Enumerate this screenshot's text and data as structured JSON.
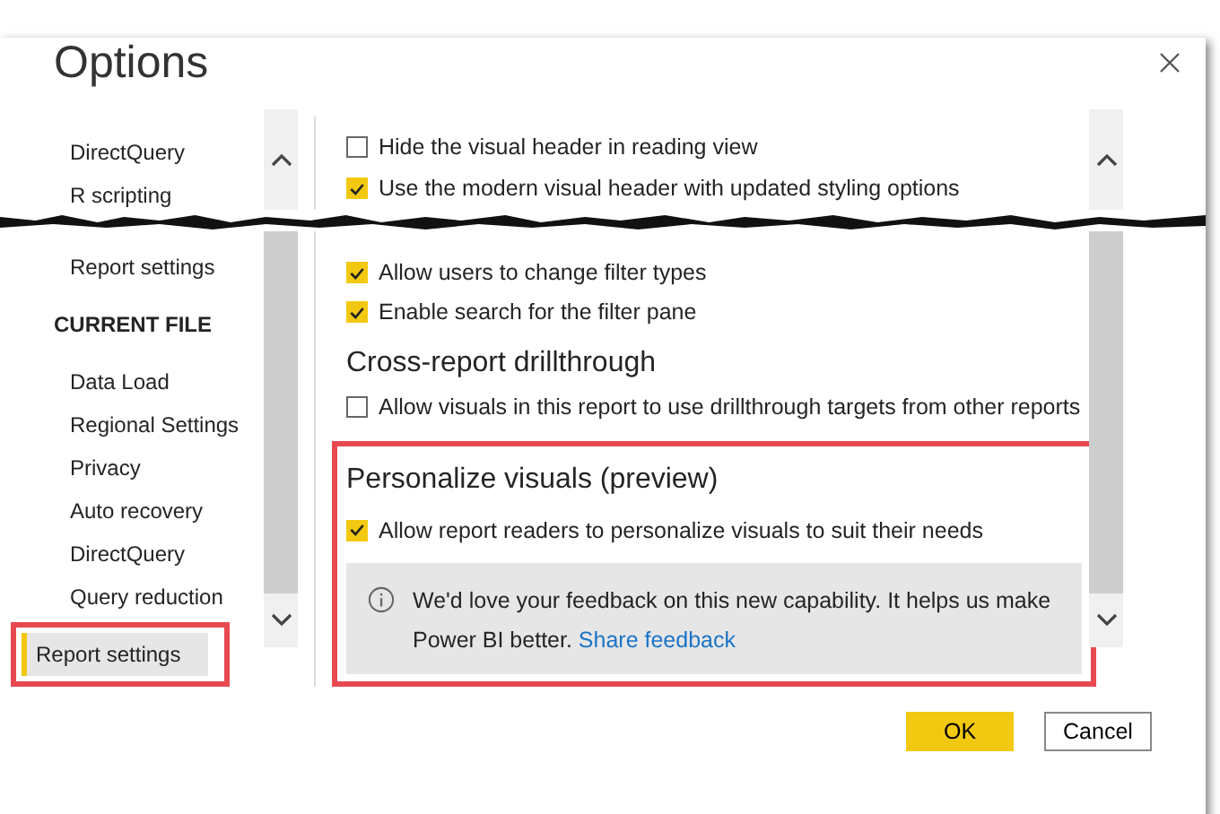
{
  "dialog": {
    "title": "Options"
  },
  "nav_top": [
    {
      "label": "DirectQuery",
      "selected": false
    },
    {
      "label": "R scripting",
      "selected": false
    }
  ],
  "nav_bottom": [
    {
      "kind": "item",
      "label": "Report settings",
      "selected": false,
      "highlighted": false
    },
    {
      "kind": "header",
      "label": "CURRENT FILE"
    },
    {
      "kind": "item",
      "label": "Data Load",
      "selected": false,
      "highlighted": false
    },
    {
      "kind": "item",
      "label": "Regional Settings",
      "selected": false,
      "highlighted": false
    },
    {
      "kind": "item",
      "label": "Privacy",
      "selected": false,
      "highlighted": false
    },
    {
      "kind": "item",
      "label": "Auto recovery",
      "selected": false,
      "highlighted": false
    },
    {
      "kind": "item",
      "label": "DirectQuery",
      "selected": false,
      "highlighted": false
    },
    {
      "kind": "item",
      "label": "Query reduction",
      "selected": false,
      "highlighted": false
    },
    {
      "kind": "item",
      "label": "Report settings",
      "selected": true,
      "highlighted": true
    }
  ],
  "options_top": [
    {
      "kind": "checkbox",
      "label": "Hide the visual header in reading view",
      "checked": false
    },
    {
      "kind": "checkbox",
      "label": "Use the modern visual header with updated styling options",
      "checked": true
    }
  ],
  "options_bottom": [
    {
      "kind": "checkbox",
      "label": "Allow users to change filter types",
      "checked": true
    },
    {
      "kind": "checkbox",
      "label": "Enable search for the filter pane",
      "checked": true
    },
    {
      "kind": "heading",
      "label": "Cross-report drillthrough"
    },
    {
      "kind": "checkbox",
      "label": "Allow visuals in this report to use drillthrough targets from other reports",
      "checked": false
    }
  ],
  "personalize": {
    "highlighted": true,
    "title": "Personalize visuals (preview)",
    "option": {
      "label": "Allow report readers to personalize visuals to suit their needs",
      "checked": true
    },
    "info": {
      "text": "We'd love your feedback on this new capability. It helps us make Power BI better.",
      "link": "Share feedback"
    }
  },
  "buttons": [
    {
      "label": "OK",
      "primary": true
    },
    {
      "label": "Cancel",
      "primary": false
    }
  ]
}
